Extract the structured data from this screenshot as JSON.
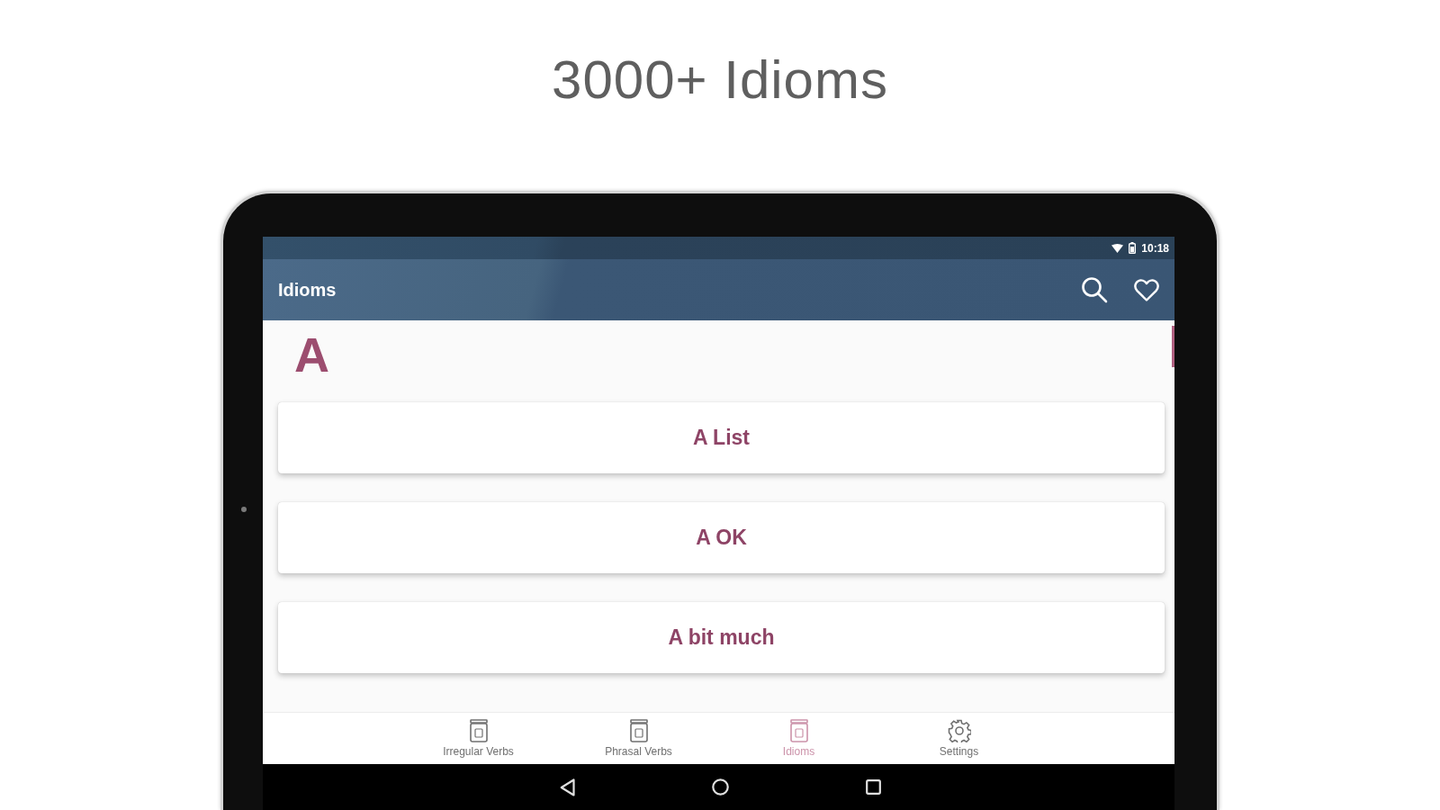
{
  "headline": "3000+ Idioms",
  "status_bar": {
    "time": "10:18"
  },
  "app_bar": {
    "title": "Idioms"
  },
  "section_letter": "A",
  "idioms": [
    {
      "text": "A List"
    },
    {
      "text": "A OK"
    },
    {
      "text": "A bit much"
    }
  ],
  "bottom_nav": [
    {
      "label": "Irregular Verbs",
      "kind": "section",
      "selected": false
    },
    {
      "label": "Phrasal Verbs",
      "kind": "section",
      "selected": false
    },
    {
      "label": "Idioms",
      "kind": "section",
      "selected": true
    },
    {
      "label": "Settings",
      "kind": "settings",
      "selected": false
    }
  ]
}
